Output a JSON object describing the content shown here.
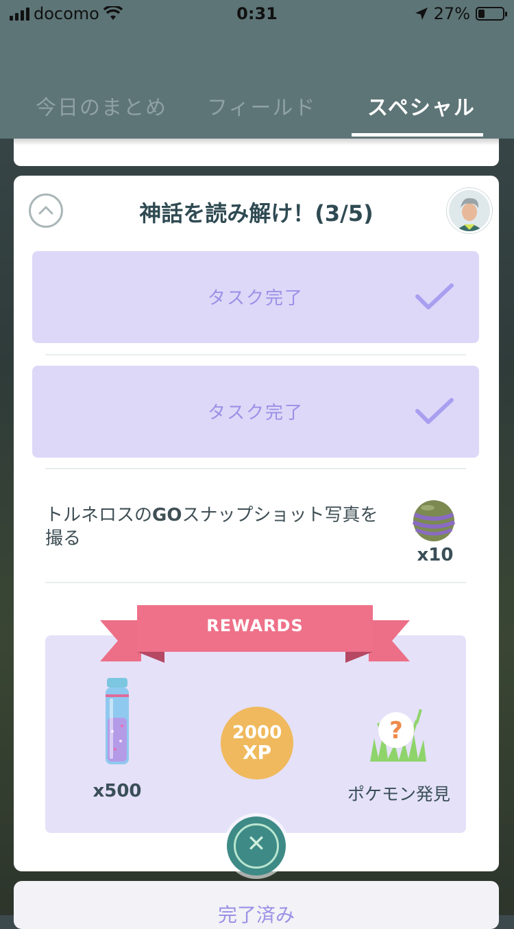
{
  "status_bar": {
    "carrier": "docomo",
    "time": "0:31",
    "battery": "27%",
    "battery_level": 0.27
  },
  "tabs": [
    {
      "label": "今日のまとめ",
      "active": false
    },
    {
      "label": "フィールド",
      "active": false
    },
    {
      "label": "スペシャル",
      "active": true
    }
  ],
  "quest": {
    "title": "神話を読み解け！(3/5)",
    "tasks_done": [
      {
        "label": "タスク完了"
      },
      {
        "label": "タスク完了"
      }
    ],
    "current_task": {
      "text_part1": "トルネロスの",
      "text_bold": "GO",
      "text_part2": "スナップショット写真を撮る",
      "reward_icon": "ball-icon",
      "reward_count": "x10"
    },
    "rewards": {
      "title": "REWARDS",
      "items": [
        {
          "icon": "stardust-vial-icon",
          "label": "x500"
        },
        {
          "icon": "xp-badge",
          "amount": "2000",
          "unit": "XP"
        },
        {
          "icon": "pokemon-encounter-icon",
          "label": "ポケモン発見"
        }
      ]
    }
  },
  "completed_section": {
    "label": "完了済み"
  },
  "colors": {
    "header": "#5e7577",
    "task_done_bg": "#ddd8f8",
    "accent_purple": "#9b90e6",
    "ribbon": "#ec6f87",
    "xp": "#f0b95d"
  }
}
